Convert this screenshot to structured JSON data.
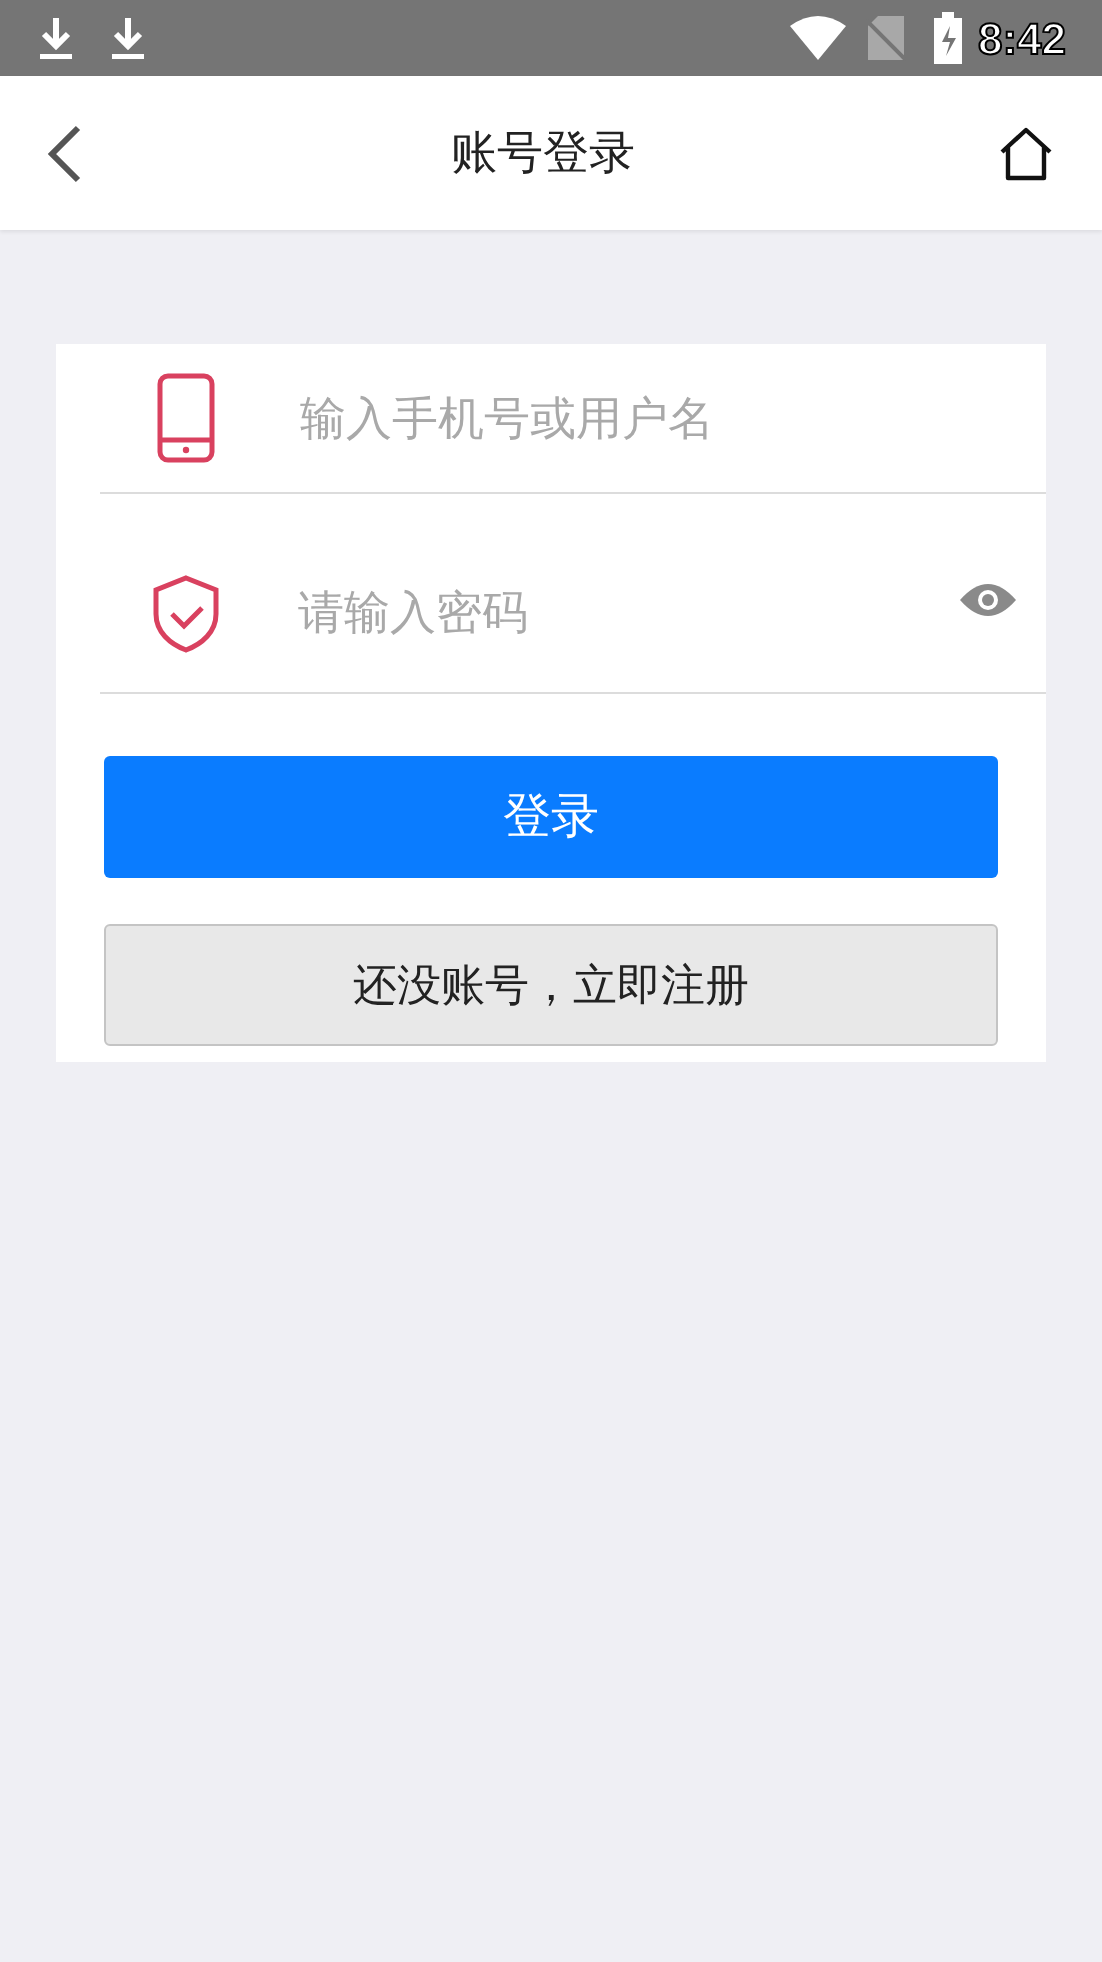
{
  "status_bar": {
    "time": "8:42"
  },
  "header": {
    "title": "账号登录"
  },
  "form": {
    "username": {
      "placeholder": "输入手机号或用户名"
    },
    "password": {
      "placeholder": "请输入密码"
    },
    "login_button": "登录",
    "register_button": "还没账号，立即注册"
  }
}
